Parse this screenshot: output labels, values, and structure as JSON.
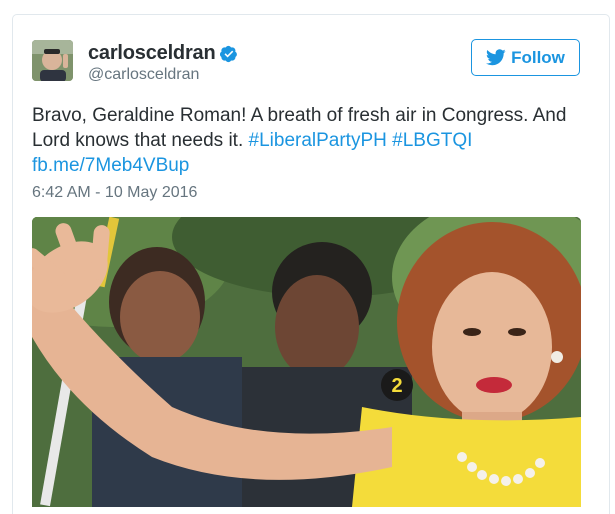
{
  "tweet": {
    "display_name": "carlosceldran",
    "handle": "@carlosceldran",
    "text_before": "Bravo, Geraldine Roman! A breath of fresh air in Congress. And Lord knows that needs it. ",
    "hashtag_1": "#LiberalPartyPH",
    "hashtag_2": "#LBGTQI",
    "link": "fb.me/7Meb4VBup",
    "timestamp": "6:42 AM - 10 May 2016",
    "media_shirt_text": "2"
  },
  "actions": {
    "follow_label": "Follow"
  },
  "colors": {
    "brand": "#1b95e0",
    "text": "#292f33",
    "muted": "#66757f",
    "border": "#e1e8ed"
  },
  "icons": {
    "verified": "verified-badge-icon",
    "follow": "twitter-bird-icon"
  }
}
